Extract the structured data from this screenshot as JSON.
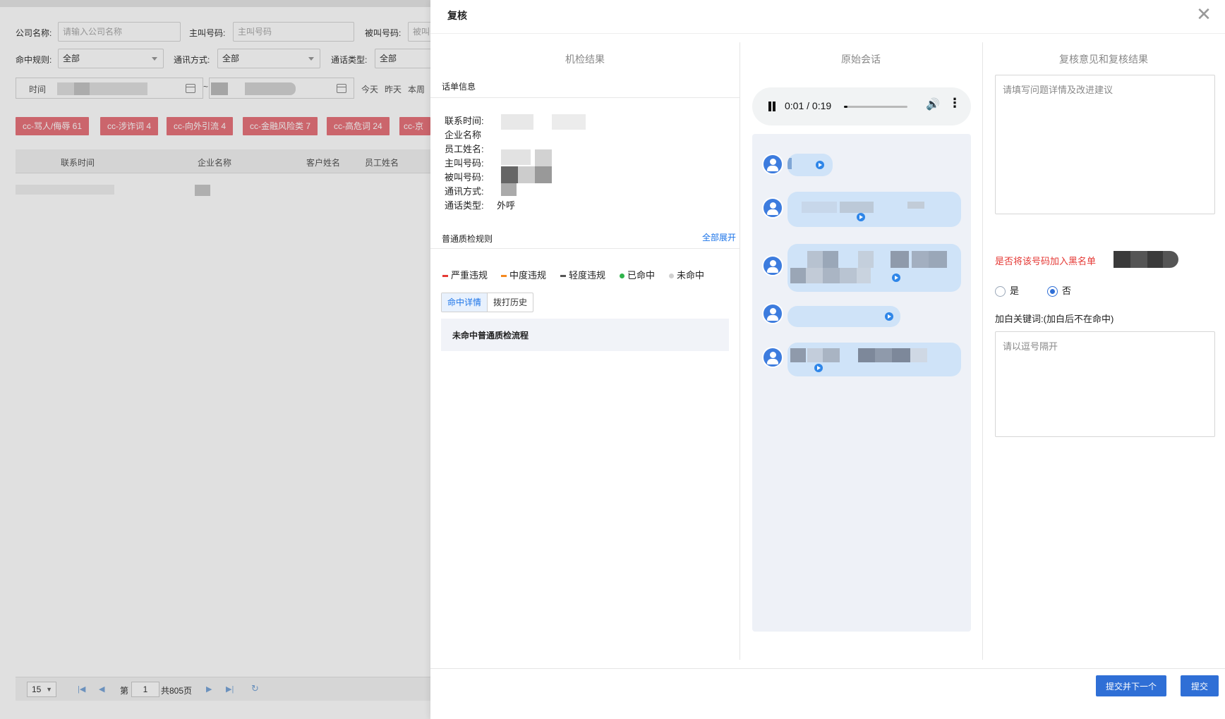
{
  "filters": {
    "company_name": {
      "label": "公司名称:",
      "placeholder": "请输入公司名称"
    },
    "caller_number": {
      "label": "主叫号码:",
      "placeholder": "主叫号码"
    },
    "callee_number": {
      "label": "被叫号码:",
      "placeholder": "被叫号"
    },
    "hit_rule": {
      "label": "命中规则:",
      "value": "全部"
    },
    "comm_method": {
      "label": "通讯方式:",
      "value": "全部"
    },
    "call_type": {
      "label": "通话类型:",
      "value": "全部"
    },
    "time": {
      "label": "时间",
      "separator": "~"
    },
    "quick": [
      "今天",
      "昨天",
      "本周"
    ]
  },
  "rule_tags": [
    "cc-骂人/侮辱 61",
    "cc-涉诈词 4",
    "cc-向外引流 4",
    "cc-金融风险类 7",
    "cc-高危词 24",
    "cc-京"
  ],
  "table": {
    "headers": [
      "联系时间",
      "企业名称",
      "客户姓名",
      "员工姓名"
    ]
  },
  "pager": {
    "page_size": "15",
    "page_prefix": "第",
    "page_current": "1",
    "page_total": "共805页"
  },
  "modal": {
    "title": "复核",
    "close": "✕",
    "col1": {
      "title": "机检结果",
      "section_call_info": "话单信息",
      "fields": [
        {
          "label": "联系时间:",
          "value": ""
        },
        {
          "label": "企业名称",
          "value": ""
        },
        {
          "label": "员工姓名:",
          "value": ""
        },
        {
          "label": "主叫号码:",
          "value": ""
        },
        {
          "label": "被叫号码:",
          "value": ""
        },
        {
          "label": "通讯方式:",
          "value": ""
        },
        {
          "label": "通话类型:",
          "value": "外呼"
        }
      ],
      "section_rules": "普通质检规则",
      "expand_all": "全部展开",
      "legend": [
        {
          "label": "严重违规",
          "color": "#e53935",
          "shape": "bar"
        },
        {
          "label": "中度违规",
          "color": "#f5891f",
          "shape": "bar"
        },
        {
          "label": "轻度违规",
          "color": "#555555",
          "shape": "bar"
        },
        {
          "label": "已命中",
          "color": "#2fb34a",
          "shape": "dot"
        },
        {
          "label": "未命中",
          "color": "#d0d0d0",
          "shape": "dot"
        }
      ],
      "tabs": [
        "命中详情",
        "拨打历史"
      ],
      "hit_panel_text": "未命中普通质检流程"
    },
    "col2": {
      "title": "原始会话",
      "audio": {
        "time": "0:01 / 0:19",
        "progress": 0.05
      }
    },
    "col3": {
      "title": "复核意见和复核结果",
      "review_placeholder": "请填写问题详情及改进建议",
      "blacklist_question": "是否将该号码加入黑名单",
      "radio_yes": "是",
      "radio_no": "否",
      "radio_selected": "否",
      "whitelist_label": "加白关键词:(加白后不在命中)",
      "whitelist_placeholder": "请以逗号隔开"
    },
    "footer": {
      "submit_next": "提交并下一个",
      "submit": "提交"
    }
  },
  "colors": {
    "accent": "#2f6fd6",
    "tag_bg": "#e8747c",
    "danger": "#e53935"
  }
}
